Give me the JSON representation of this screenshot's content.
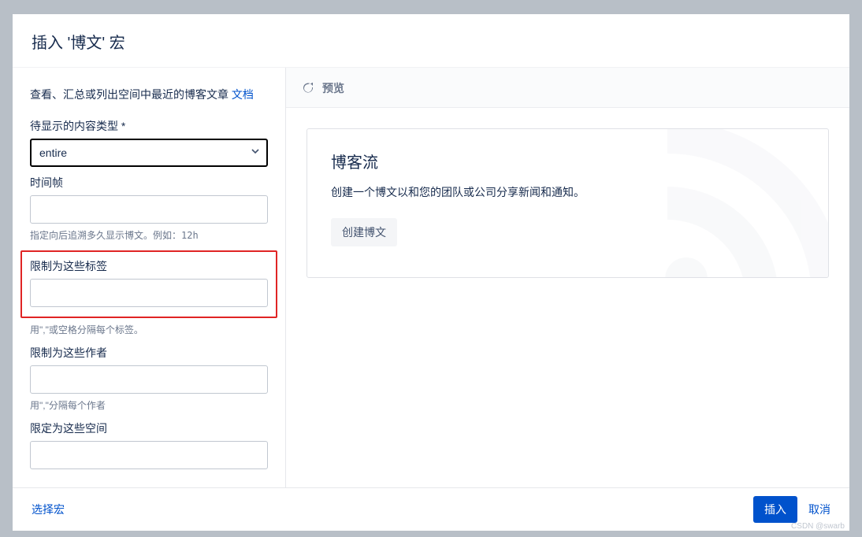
{
  "dialog": {
    "title": "插入 '博文' 宏"
  },
  "form": {
    "description_prefix": "查看、汇总或列出空间中最近的博客文章 ",
    "doc_link": "文档",
    "content_type": {
      "label": "待显示的内容类型",
      "value": "entire"
    },
    "timeframe": {
      "label": "时间帧",
      "help_prefix": "指定向后追溯多久显示博文。例如：",
      "help_code": "12h"
    },
    "labels": {
      "label": "限制为这些标签",
      "help": "用\",\"或空格分隔每个标签。"
    },
    "authors": {
      "label": "限制为这些作者",
      "help": "用\",\"分隔每个作者"
    },
    "spaces": {
      "label": "限定为这些空间"
    }
  },
  "preview": {
    "label": "预览",
    "card": {
      "title": "博客流",
      "description": "创建一个博文以和您的团队或公司分享新闻和通知。",
      "button": "创建博文"
    }
  },
  "footer": {
    "select_macro": "选择宏",
    "insert": "插入",
    "cancel": "取消"
  },
  "watermark": "CSDN @swarb"
}
